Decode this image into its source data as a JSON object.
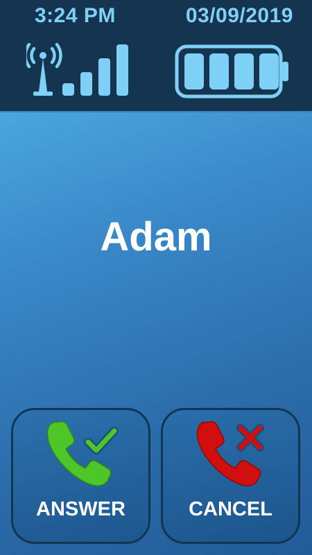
{
  "status_bar": {
    "time": "3:24 PM",
    "date": "03/09/2019",
    "signal_icon": "signal-tower-icon",
    "signal_level": 4,
    "signal_max": 4,
    "battery_icon": "battery-icon",
    "battery_level": 1.0
  },
  "call": {
    "caller_name": "Adam"
  },
  "actions": {
    "answer_label": "ANSWER",
    "answer_icon": "phone-check-icon",
    "cancel_label": "CANCEL",
    "cancel_icon": "phone-cross-icon"
  },
  "colors": {
    "status_text": "#7fd0f7",
    "answer_green": "#4ec62a",
    "cancel_red": "#d10f0f"
  }
}
